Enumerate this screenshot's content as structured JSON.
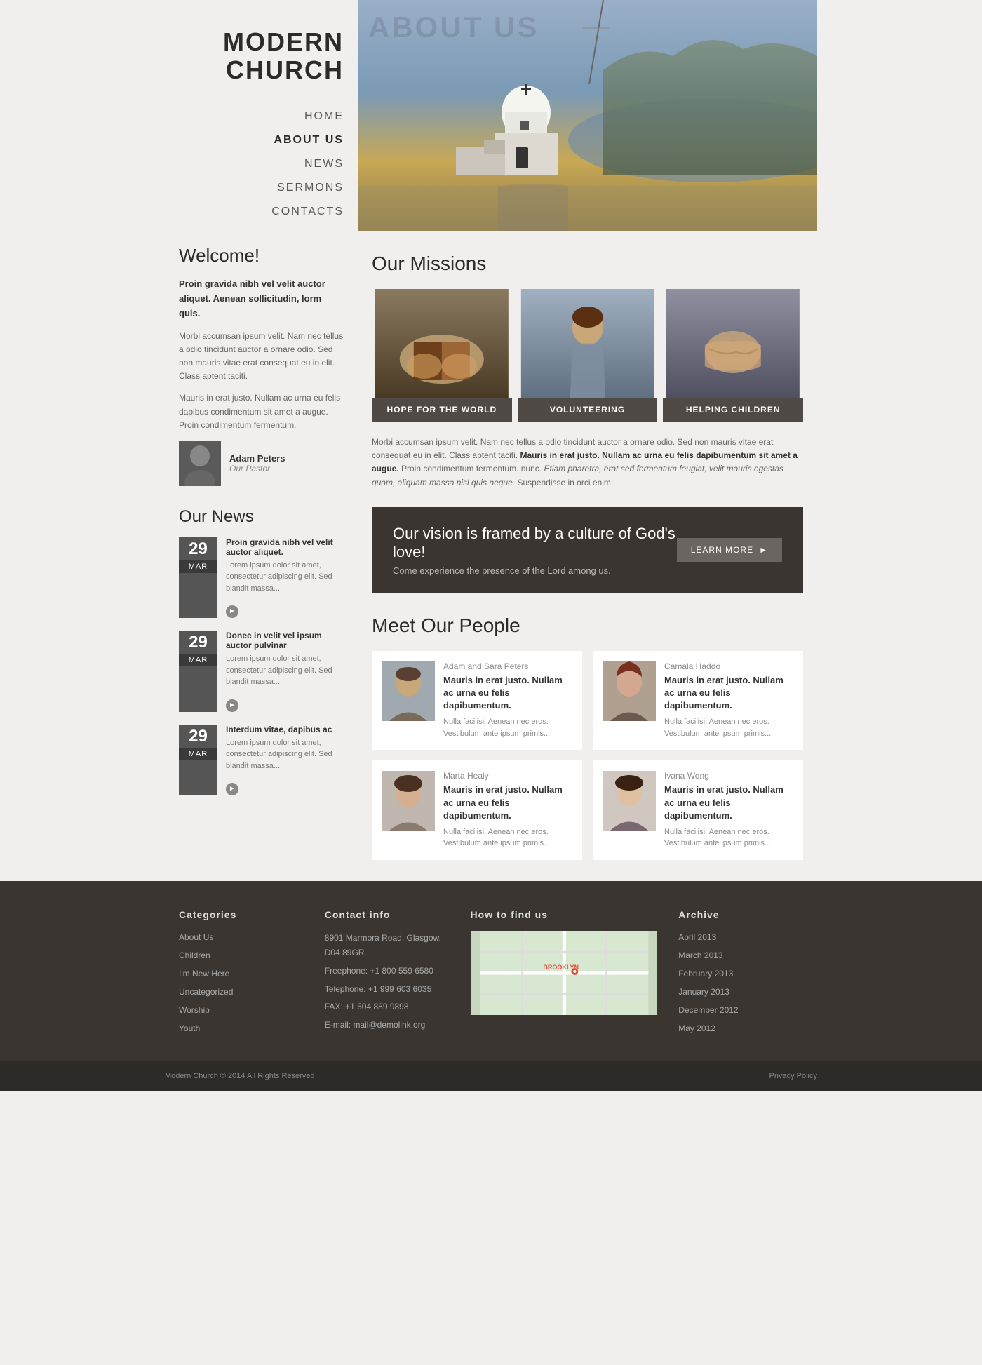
{
  "site": {
    "logo_line1": "MODERN",
    "logo_line2": "CHURCH"
  },
  "nav": {
    "items": [
      {
        "label": "HOME",
        "active": false
      },
      {
        "label": "ABOUT US",
        "active": true
      },
      {
        "label": "NEWS",
        "active": false
      },
      {
        "label": "SERMONS",
        "active": false
      },
      {
        "label": "CONTACTS",
        "active": false
      }
    ]
  },
  "sidebar": {
    "welcome_title": "Welcome!",
    "bold_intro": "Proin gravida nibh vel velit auctor aliquet. Aenean sollicitudin, lorm quis.",
    "para1": "Morbi accumsan ipsum velit. Nam nec tellus a odio tincidunt auctor a ornare odio. Sed non  mauris vitae erat consequat eu in elit. Class aptent taciti.",
    "para2": "Mauris in erat justo. Nullam ac urna eu felis dapibus condimentum sit amet a augue. Proin condimentum fermentum.",
    "pastor_name": "Adam Peters",
    "pastor_title": "Our Pastor",
    "news_title": "Our News",
    "news_items": [
      {
        "day": "29",
        "month": "MAR",
        "headline": "Proin gravida nibh vel velit auctor aliquet.",
        "body": "Lorem ipsum dolor sit amet, consectetur adipiscing elit. Sed blandit massa..."
      },
      {
        "day": "29",
        "month": "MAR",
        "headline": "Donec in velit vel ipsum auctor pulvinar",
        "body": "Lorem ipsum dolor sit amet, consectetur adipiscing elit. Sed blandit massa..."
      },
      {
        "day": "29",
        "month": "MAR",
        "headline": "Interdum vitae, dapibus ac",
        "body": "Lorem ipsum dolor sit amet, consectetur adipiscing elit. Sed blandit massa..."
      }
    ]
  },
  "hero": {
    "about_us_label": "ABOUT US"
  },
  "missions": {
    "title": "Our Missions",
    "cards": [
      {
        "label": "HOPE FOR THE WORLD"
      },
      {
        "label": "VOLUNTEERING"
      },
      {
        "label": "HELPING CHILDREN"
      }
    ],
    "description_normal": "Morbi accumsan ipsum velit. Nam nec tellus a odio tincidunt auctor a ornare odio. Sed non  mauris vitae erat consequat eu in elit. Class aptent taciti. ",
    "description_bold": "Mauris in erat justo. Nullam ac urna eu felis dapibumentum sit amet a augue.",
    "description_mid": " Proin condimentum fermentum. nunc. ",
    "description_italic": "Etiam pharetra, erat sed fermentum feugiat, velit mauris egestas quam, aliquam massa nisl quis neque.",
    "description_end": " Suspendisse in orci enim."
  },
  "vision": {
    "headline": "Our vision is framed by a culture of God's love!",
    "sub": "Come experience the presence of the Lord among us.",
    "button_label": "LEARN MORE"
  },
  "people": {
    "title": "Meet Our People",
    "list": [
      {
        "name": "Adam and Sara Peters",
        "desc": "Mauris in erat justo. Nullam ac urna eu felis dapibumentum.",
        "extra": "Nulla facilisi. Aenean nec eros. Vestibulum ante ipsum primis..."
      },
      {
        "name": "Camala Haddo",
        "desc": "Mauris in erat justo. Nullam ac urna eu felis dapibumentum.",
        "extra": "Nulla facilisi. Aenean nec eros. Vestibulum ante ipsum primis..."
      },
      {
        "name": "Marta Healy",
        "desc": "Mauris in erat justo. Nullam ac urna eu felis dapibumentum.",
        "extra": "Nulla facilisi. Aenean nec eros. Vestibulum ante ipsum primis..."
      },
      {
        "name": "Ivana Wong",
        "desc": "Mauris in erat justo. Nullam ac urna eu felis dapibumentum.",
        "extra": "Nulla facilisi. Aenean nec eros. Vestibulum ante ipsum primis..."
      }
    ]
  },
  "footer": {
    "categories_title": "Categories",
    "categories": [
      {
        "label": "About Us"
      },
      {
        "label": "Children"
      },
      {
        "label": "I'm New Here"
      },
      {
        "label": "Uncategorized"
      },
      {
        "label": "Worship"
      },
      {
        "label": "Youth"
      }
    ],
    "contact_title": "Contact info",
    "contact_address": "8901 Marmora Road, Glasgow, D04 89GR.",
    "contact_freephone": "Freephone: +1 800 559 6580",
    "contact_telephone": "Telephone: +1 999 603 6035",
    "contact_fax": "FAX: +1 504 889 9898",
    "contact_email_label": "E-mail: ",
    "contact_email": "mail@demolink.org",
    "howto_title": "How to find us",
    "archive_title": "Archive",
    "archive_items": [
      {
        "label": "April 2013"
      },
      {
        "label": "March 2013"
      },
      {
        "label": "February 2013"
      },
      {
        "label": "January 2013"
      },
      {
        "label": "December 2012"
      },
      {
        "label": "May 2012"
      }
    ],
    "copyright": "Modern Church © 2014 All Rights Reserved",
    "privacy": "Privacy Policy"
  }
}
